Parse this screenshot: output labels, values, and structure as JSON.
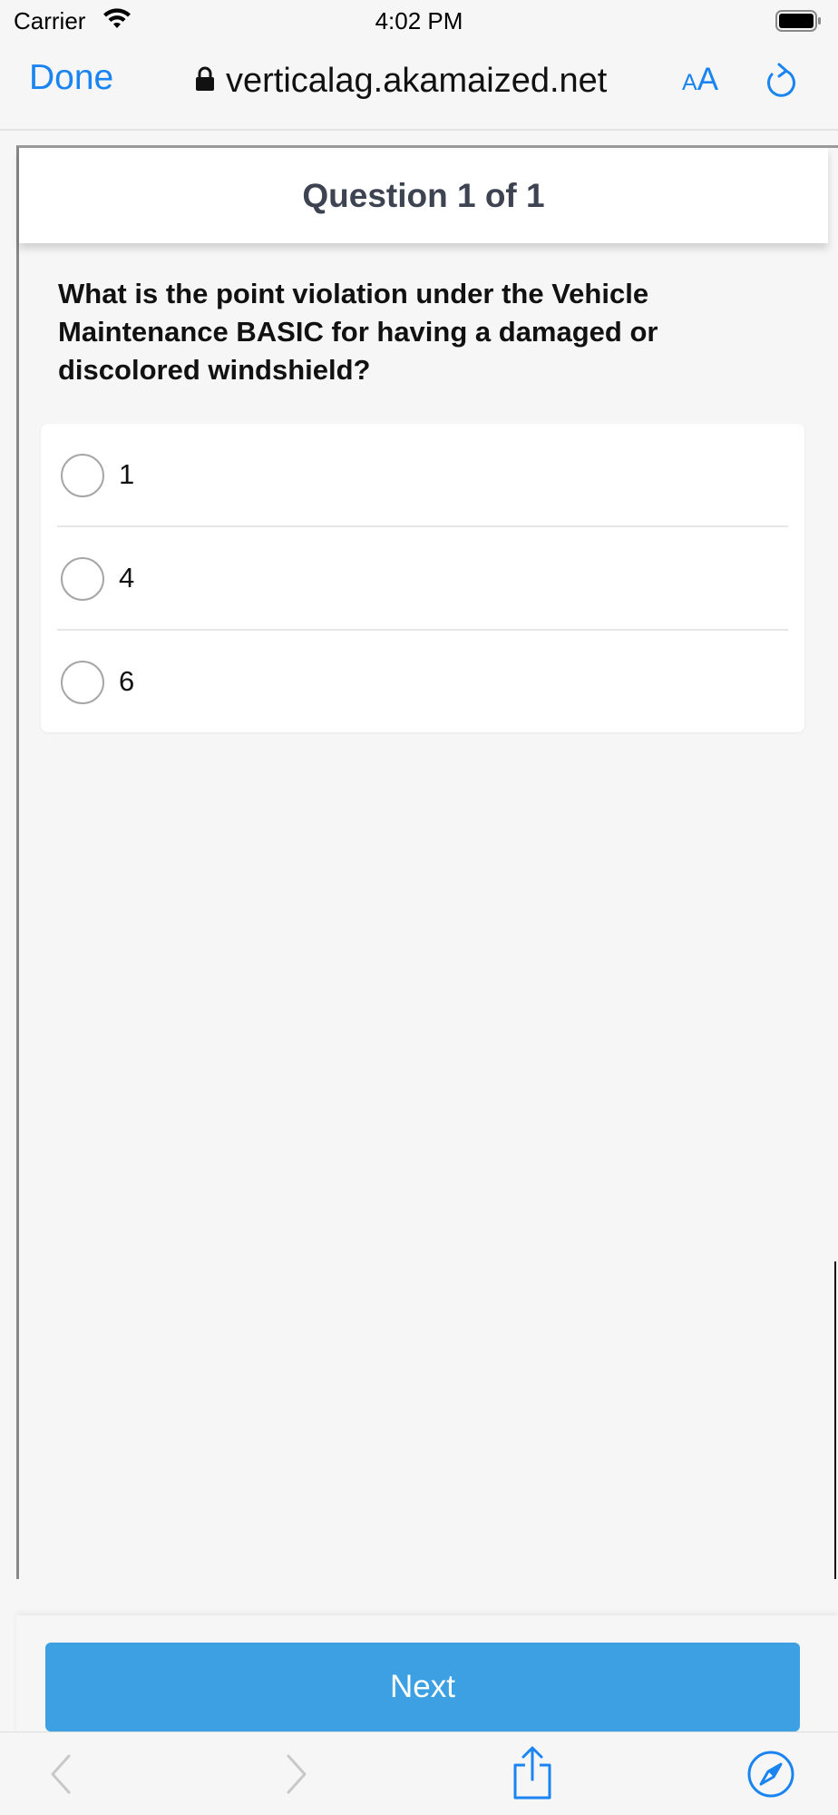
{
  "status_bar": {
    "carrier": "Carrier",
    "time": "4:02 PM"
  },
  "nav_bar": {
    "done_label": "Done",
    "url": "verticalag.akamaized.net",
    "text_size_small": "A",
    "text_size_large": "A"
  },
  "quiz": {
    "header": "Question 1 of 1",
    "question": "What is the point violation under the Vehicle Maintenance BASIC for having a damaged or discolored windshield?",
    "options": [
      {
        "label": "1",
        "selected": false
      },
      {
        "label": "4",
        "selected": false
      },
      {
        "label": "6",
        "selected": false
      }
    ],
    "next_label": "Next"
  },
  "colors": {
    "accent": "#1a84f0",
    "next_button": "#3ca0e2",
    "header_text": "#3d4350"
  },
  "toolbar": {
    "icons": [
      "back-icon",
      "forward-icon",
      "share-icon",
      "compass-icon"
    ]
  }
}
